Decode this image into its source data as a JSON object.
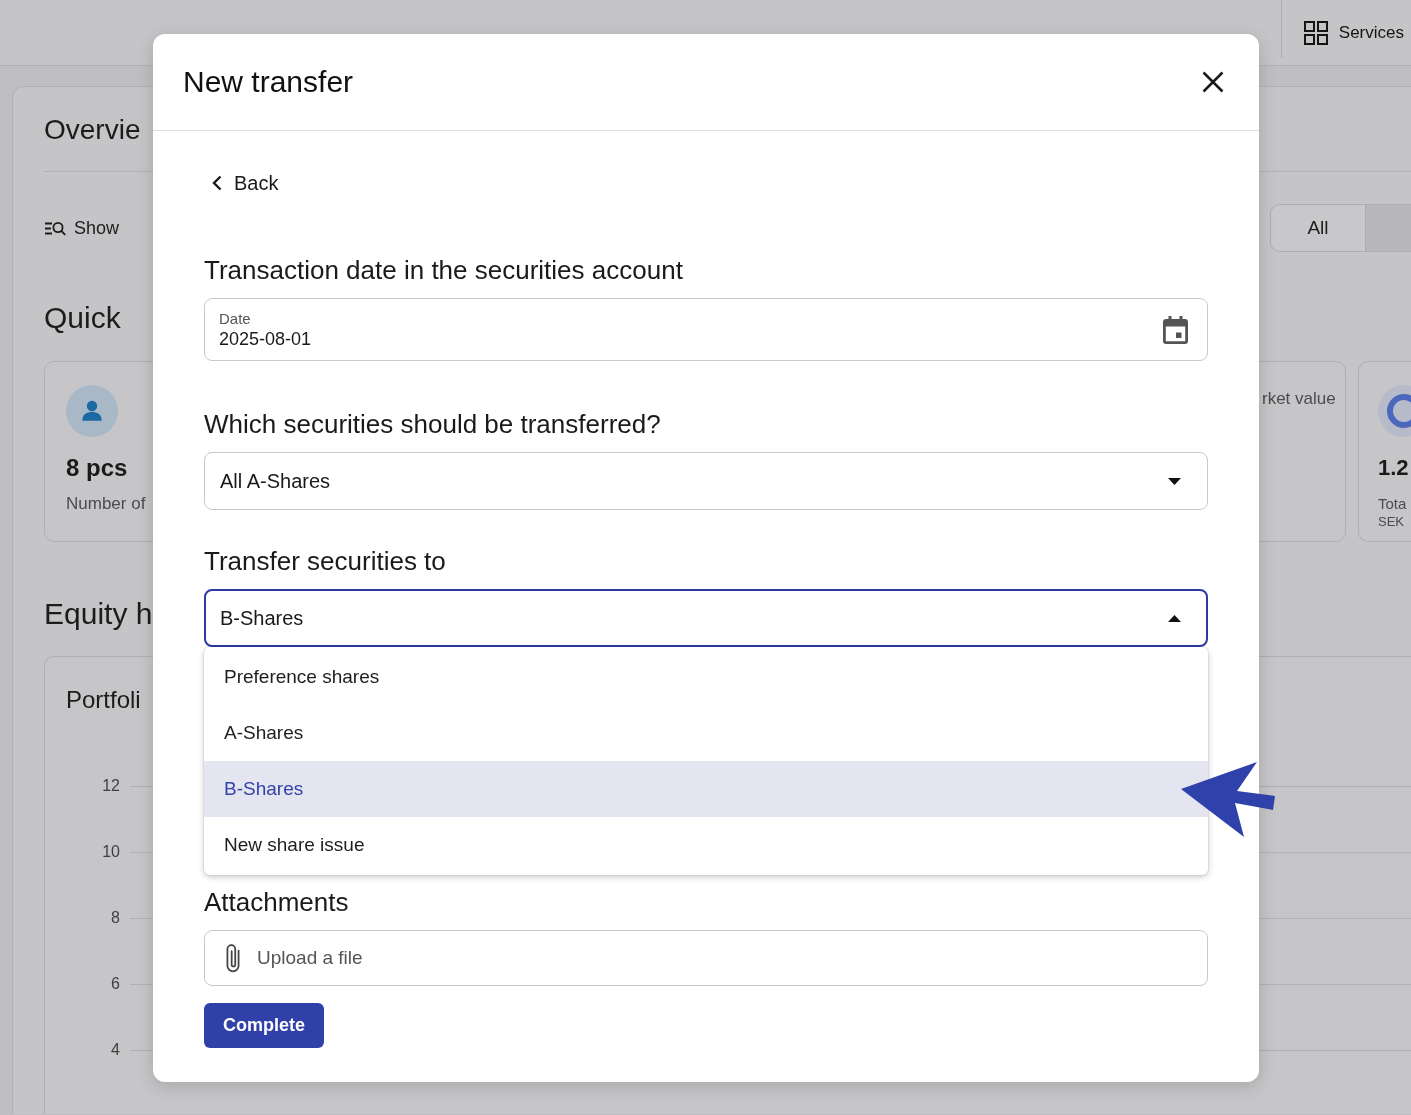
{
  "background": {
    "top_bar": {
      "services_label": "Services"
    },
    "overview": {
      "title": "Overvie",
      "show_label": "Show",
      "filter_label": "All"
    },
    "quick": {
      "title": "Quick",
      "cards": [
        {
          "kind": "person",
          "value": "8 pcs",
          "label": "Number of"
        },
        {
          "kind": "plain",
          "label": "rket value"
        },
        {
          "kind": "ring",
          "value": "1.2",
          "label": "Tota",
          "unit": "SEK"
        }
      ]
    },
    "equity": {
      "title": "Equity h",
      "chart_title": "Portfoli",
      "y_axis_labels": [
        "12",
        "10",
        "8",
        "6",
        "4"
      ]
    }
  },
  "modal": {
    "title": "New transfer",
    "back_label": "Back",
    "sections": [
      {
        "kind": "date",
        "heading": "Transaction date in the securities account",
        "label": "Date",
        "value": "2025-08-01"
      },
      {
        "kind": "select",
        "heading": "Which securities should be transferred?",
        "value": "All A-Shares",
        "expanded": false
      },
      {
        "kind": "select",
        "heading": "Transfer securities to",
        "value": "B-Shares",
        "expanded": true,
        "options": [
          {
            "label": "Preference shares",
            "selected": false
          },
          {
            "label": "A-Shares",
            "selected": false
          },
          {
            "label": "B-Shares",
            "selected": true
          },
          {
            "label": "New share issue",
            "selected": false
          }
        ]
      },
      {
        "kind": "upload",
        "heading": "Attachments",
        "placeholder": "Upload a file"
      }
    ],
    "submit_label": "Complete"
  }
}
